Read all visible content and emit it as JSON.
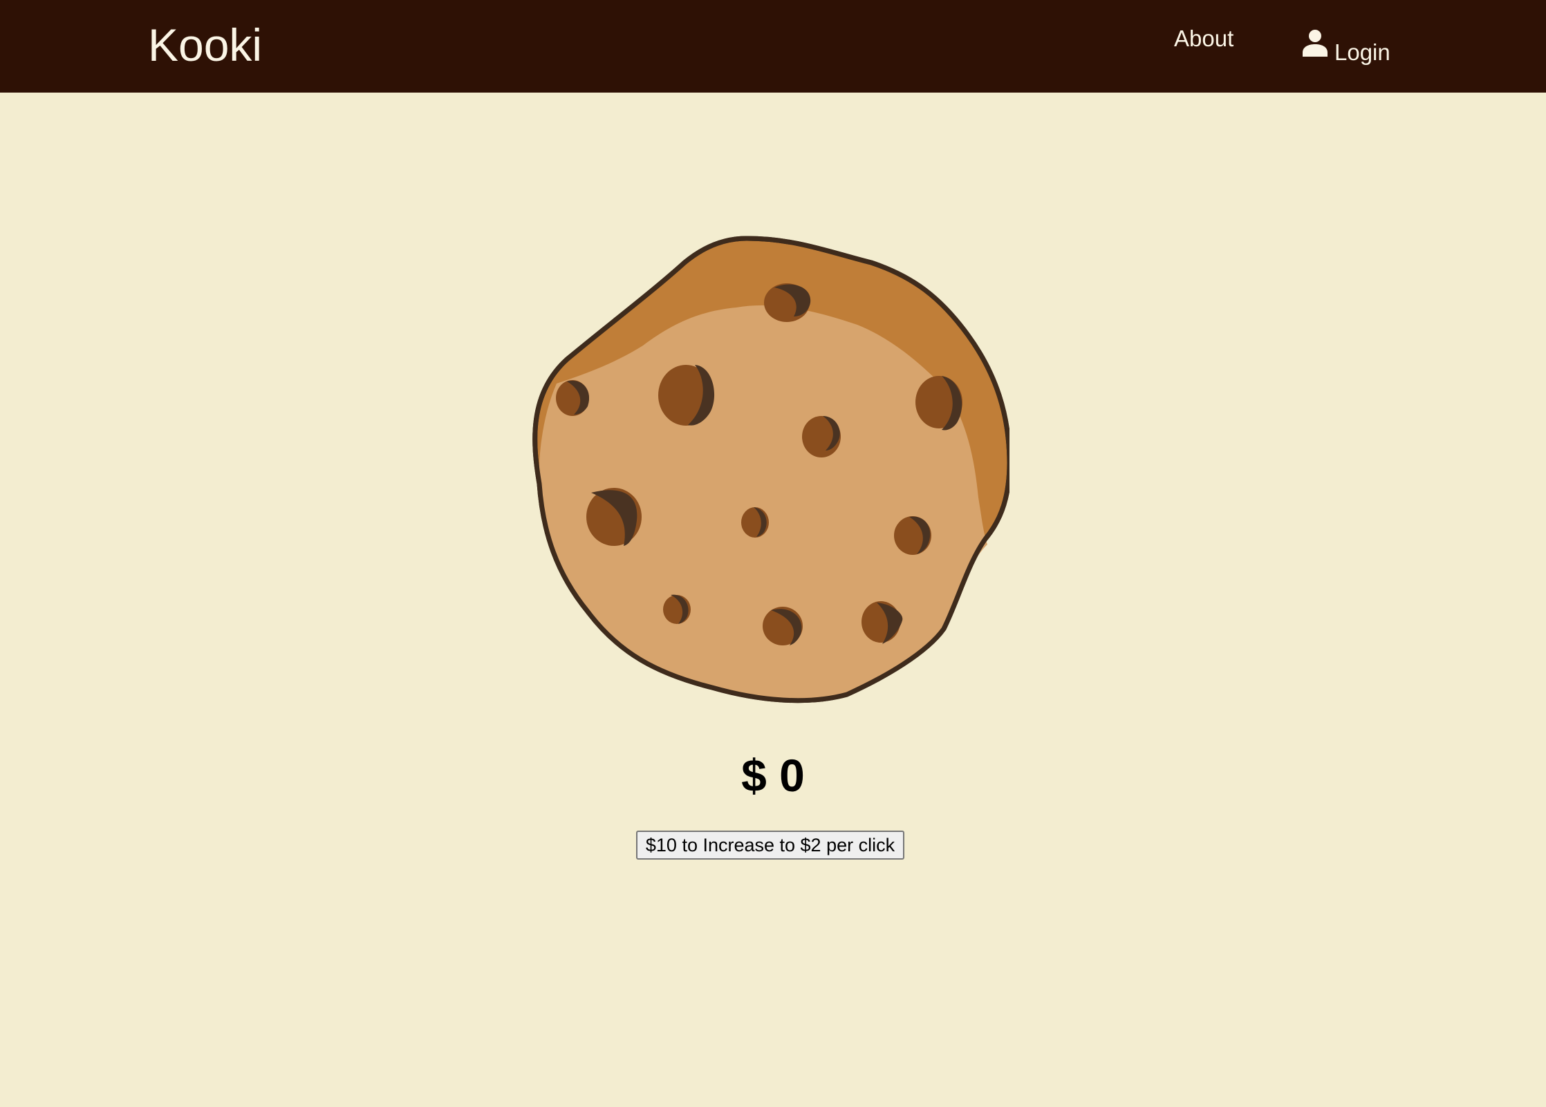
{
  "navbar": {
    "brand": "Kooki",
    "about_label": "About",
    "login_label": "Login",
    "login_icon": "user-icon",
    "background_color": "#2E1105",
    "text_color": "#FBF5E6"
  },
  "main": {
    "cookie_image": "cookie-icon",
    "balance": "$ 0",
    "upgrade_button_label": "$10 to Increase to $2 per click",
    "background_color": "#F3EDD0"
  }
}
